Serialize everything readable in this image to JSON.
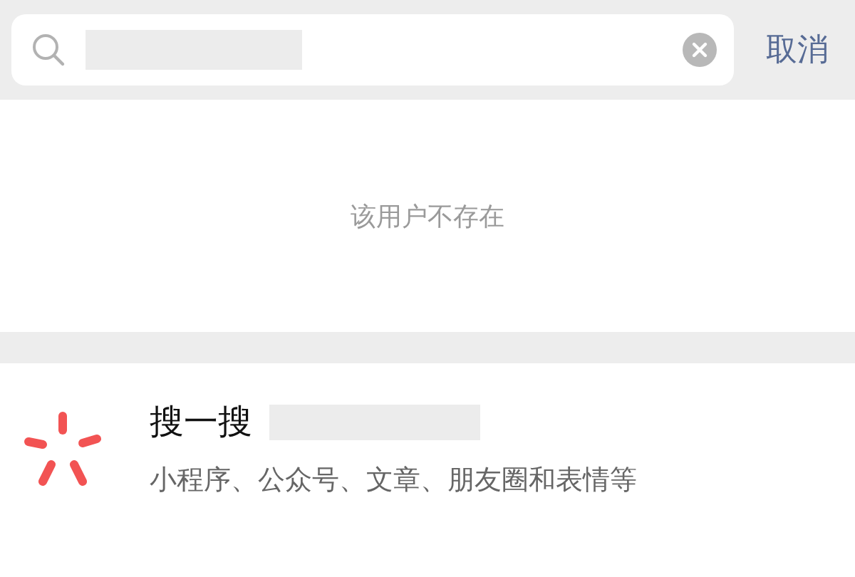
{
  "search_bar": {
    "cancel": "取消"
  },
  "result": {
    "message": "该用户不存在"
  },
  "search_one": {
    "title": "搜一搜",
    "subtitle": "小程序、公众号、文章、朋友圈和表情等"
  }
}
